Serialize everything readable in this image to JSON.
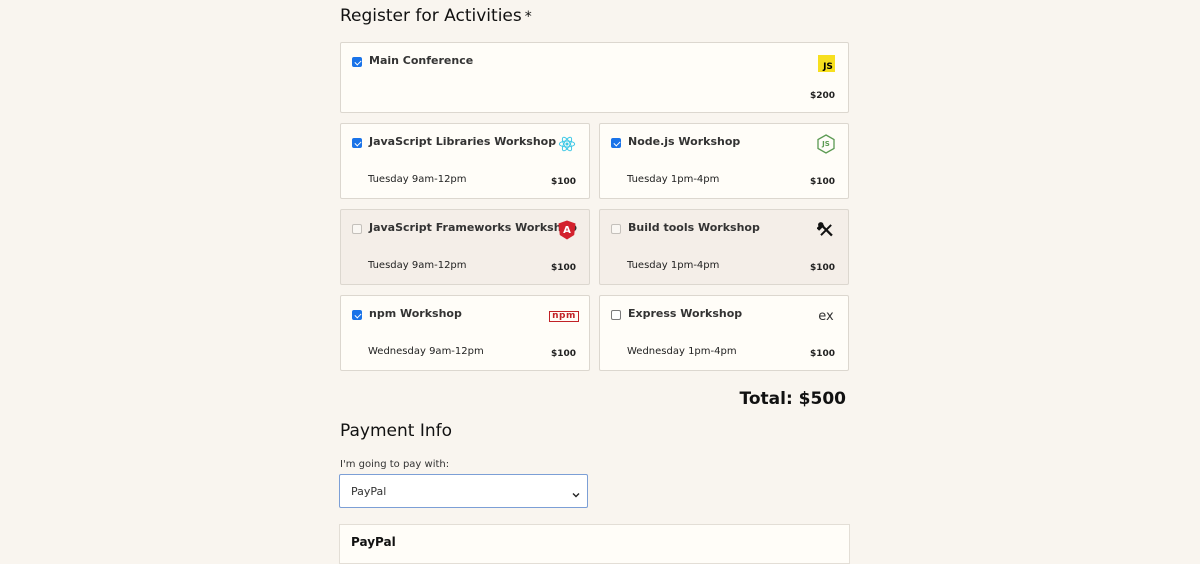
{
  "activities": {
    "title": "Register for Activities",
    "required_mark": "*",
    "main": {
      "name": "Main Conference",
      "price": "$200",
      "checked": true,
      "icon": "javascript-icon",
      "icon_text": "JS"
    },
    "workshops": [
      {
        "name": "JavaScript Libraries Workshop",
        "time": "Tuesday 9am-12pm",
        "price": "$100",
        "checked": true,
        "disabled": false,
        "icon": "react-icon"
      },
      {
        "name": "Node.js Workshop",
        "time": "Tuesday 1pm-4pm",
        "price": "$100",
        "checked": true,
        "disabled": false,
        "icon": "nodejs-icon",
        "icon_text": "JS"
      },
      {
        "name": "JavaScript Frameworks Workshop",
        "time": "Tuesday 9am-12pm",
        "price": "$100",
        "checked": false,
        "disabled": true,
        "icon": "angular-icon",
        "icon_text": "A"
      },
      {
        "name": "Build tools Workshop",
        "time": "Tuesday 1pm-4pm",
        "price": "$100",
        "checked": false,
        "disabled": true,
        "icon": "build-tools-icon"
      },
      {
        "name": "npm Workshop",
        "time": "Wednesday 9am-12pm",
        "price": "$100",
        "checked": true,
        "disabled": false,
        "icon": "npm-icon",
        "icon_text": "npm"
      },
      {
        "name": "Express Workshop",
        "time": "Wednesday 1pm-4pm",
        "price": "$100",
        "checked": false,
        "disabled": false,
        "icon": "express-icon",
        "icon_text": "ex"
      }
    ],
    "total": "Total: $500"
  },
  "payment": {
    "title": "Payment Info",
    "select_label": "I'm going to pay with:",
    "selected": "PayPal",
    "paypal_title": "PayPal"
  },
  "colors": {
    "background": "#f9f5ef",
    "checkbox_checked": "#1a73e8",
    "react": "#3ec8e6",
    "node": "#5b9a52",
    "angular": "#d3212d",
    "npm": "#c12127",
    "js_yellow": "#f7df1e"
  }
}
